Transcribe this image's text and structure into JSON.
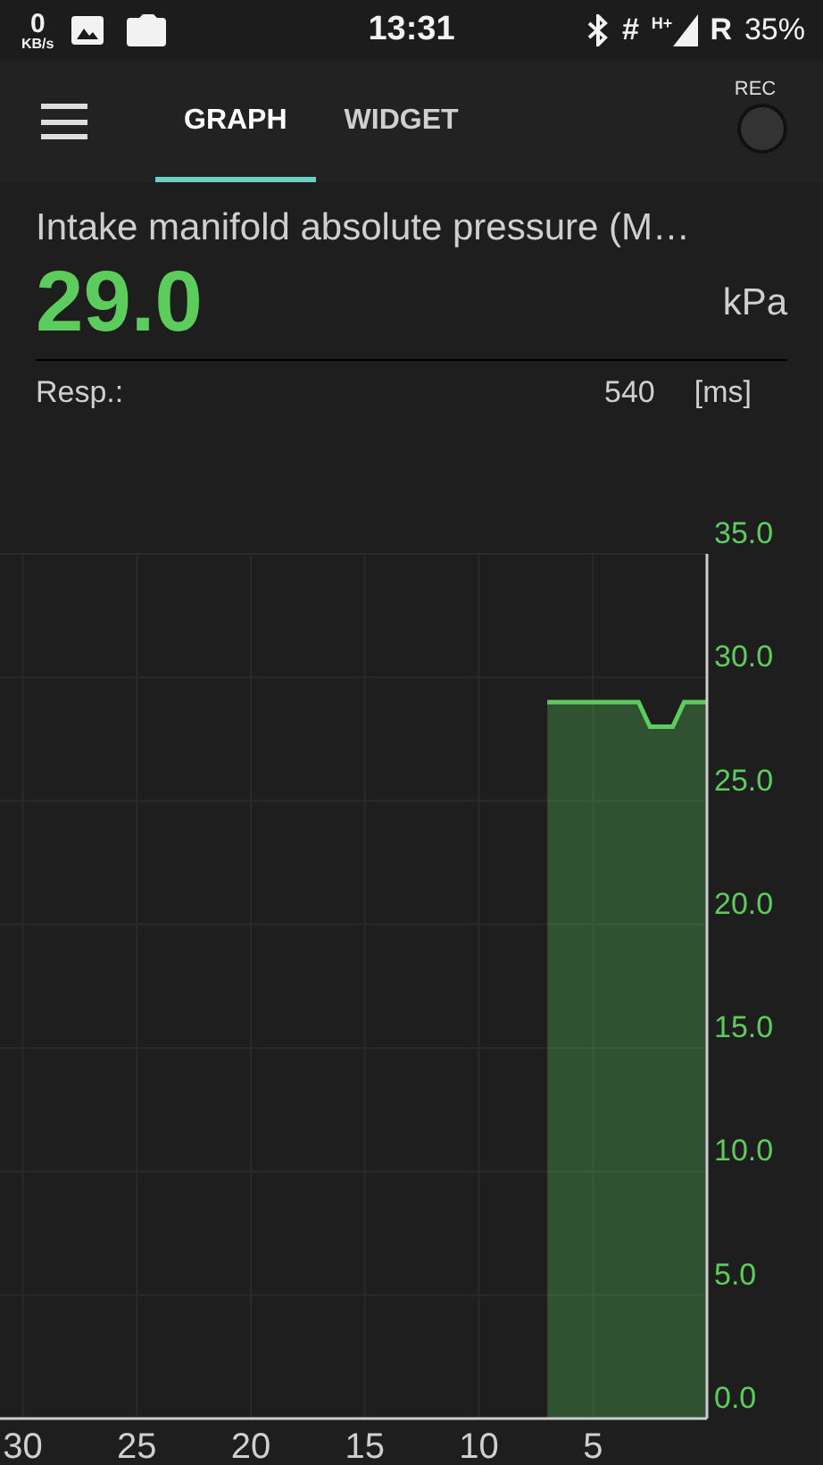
{
  "status_bar": {
    "speed": "0",
    "speed_unit": "KB/s",
    "time": "13:31",
    "hash": "#",
    "network": "H+",
    "roaming": "R",
    "battery": "35%"
  },
  "toolbar": {
    "tabs": [
      {
        "label": "GRAPH",
        "selected": true
      },
      {
        "label": "WIDGET",
        "selected": false
      }
    ],
    "rec_label": "REC"
  },
  "sensor": {
    "title": "Intake manifold absolute pressure (M…",
    "value": "29.0",
    "unit": "kPa",
    "resp_label": "Resp.:",
    "resp_value": "540",
    "resp_unit": "[ms]"
  },
  "chart_data": {
    "type": "area",
    "grid": true,
    "x": [
      7,
      3,
      2.5,
      1.5,
      1,
      0
    ],
    "xlim": [
      31,
      0
    ],
    "ylim": [
      0,
      35
    ],
    "xticks": [
      30,
      25,
      20,
      15,
      10,
      5
    ],
    "yticks": [
      {
        "value": 0,
        "label": "0.0"
      },
      {
        "value": 5,
        "label": "5.0"
      },
      {
        "value": 10,
        "label": "10.0"
      },
      {
        "value": 15,
        "label": "15.0"
      },
      {
        "value": 20,
        "label": "20.0"
      },
      {
        "value": 25,
        "label": "25.0"
      },
      {
        "value": 30,
        "label": "30.0"
      },
      {
        "value": 35,
        "label": "35.0"
      }
    ],
    "series": [
      {
        "color": "#5ccc5c",
        "values": [
          29,
          29,
          28,
          28,
          29,
          29
        ]
      }
    ]
  }
}
